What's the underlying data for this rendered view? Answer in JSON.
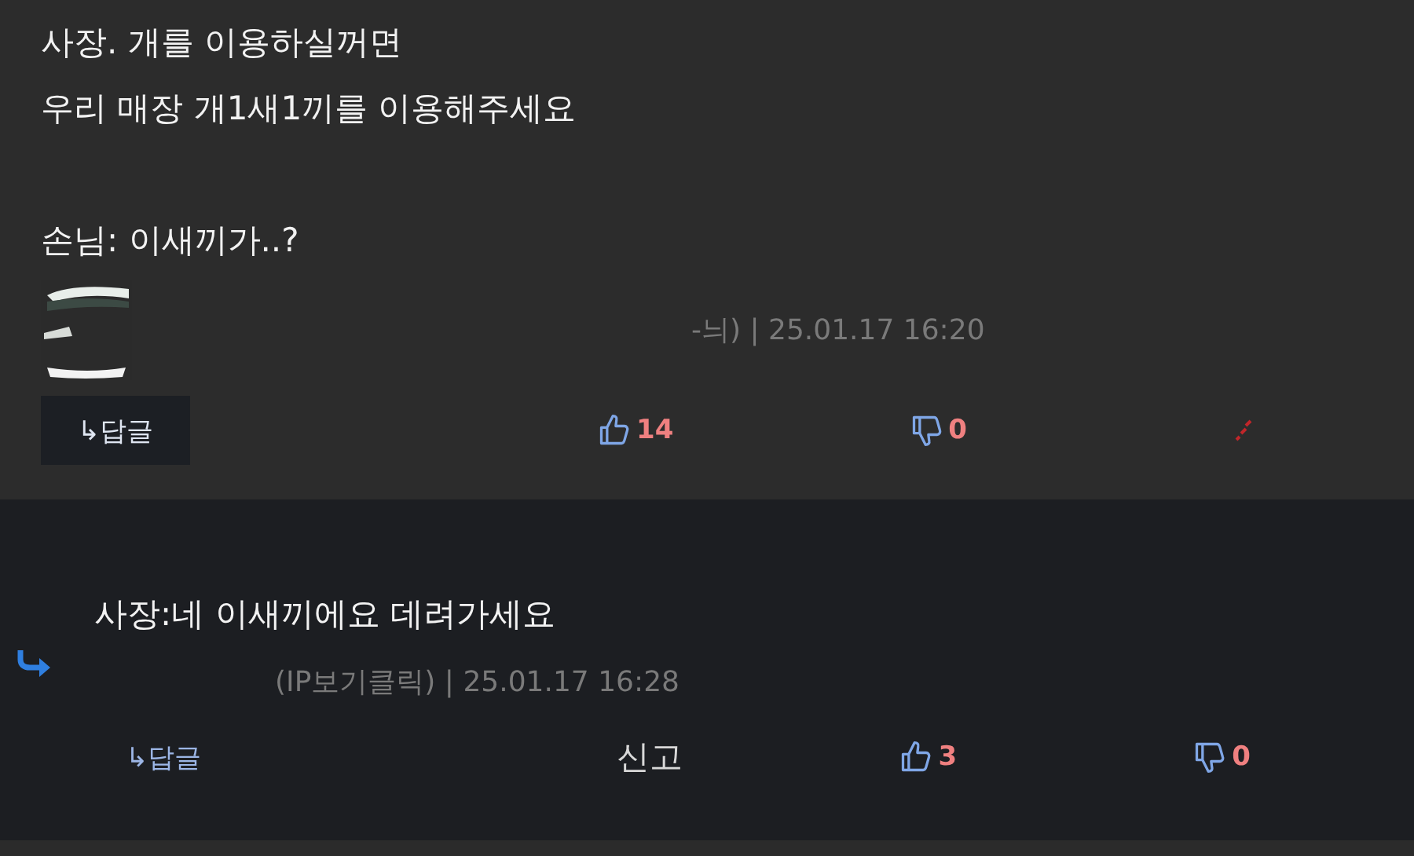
{
  "comments": [
    {
      "kind": "comment",
      "paragraphs": [
        [
          "사장. 개를 이용하실꺼면",
          "우리 매장 개1새1끼를 이용해주세요"
        ],
        [
          "손님: 이새끼가..?"
        ]
      ],
      "meta": "-늬) | 25.01.17 16:20",
      "reply": "↳답글",
      "likes": "14",
      "dislikes": "0"
    },
    {
      "kind": "reply",
      "paragraphs": [
        [
          "사장:네 이새끼에요 데려가세요"
        ]
      ],
      "meta": "(IP보기클릭) | 25.01.17 16:28",
      "reply": "↳답글",
      "report": "신고",
      "likes": "3",
      "dislikes": "0"
    }
  ]
}
